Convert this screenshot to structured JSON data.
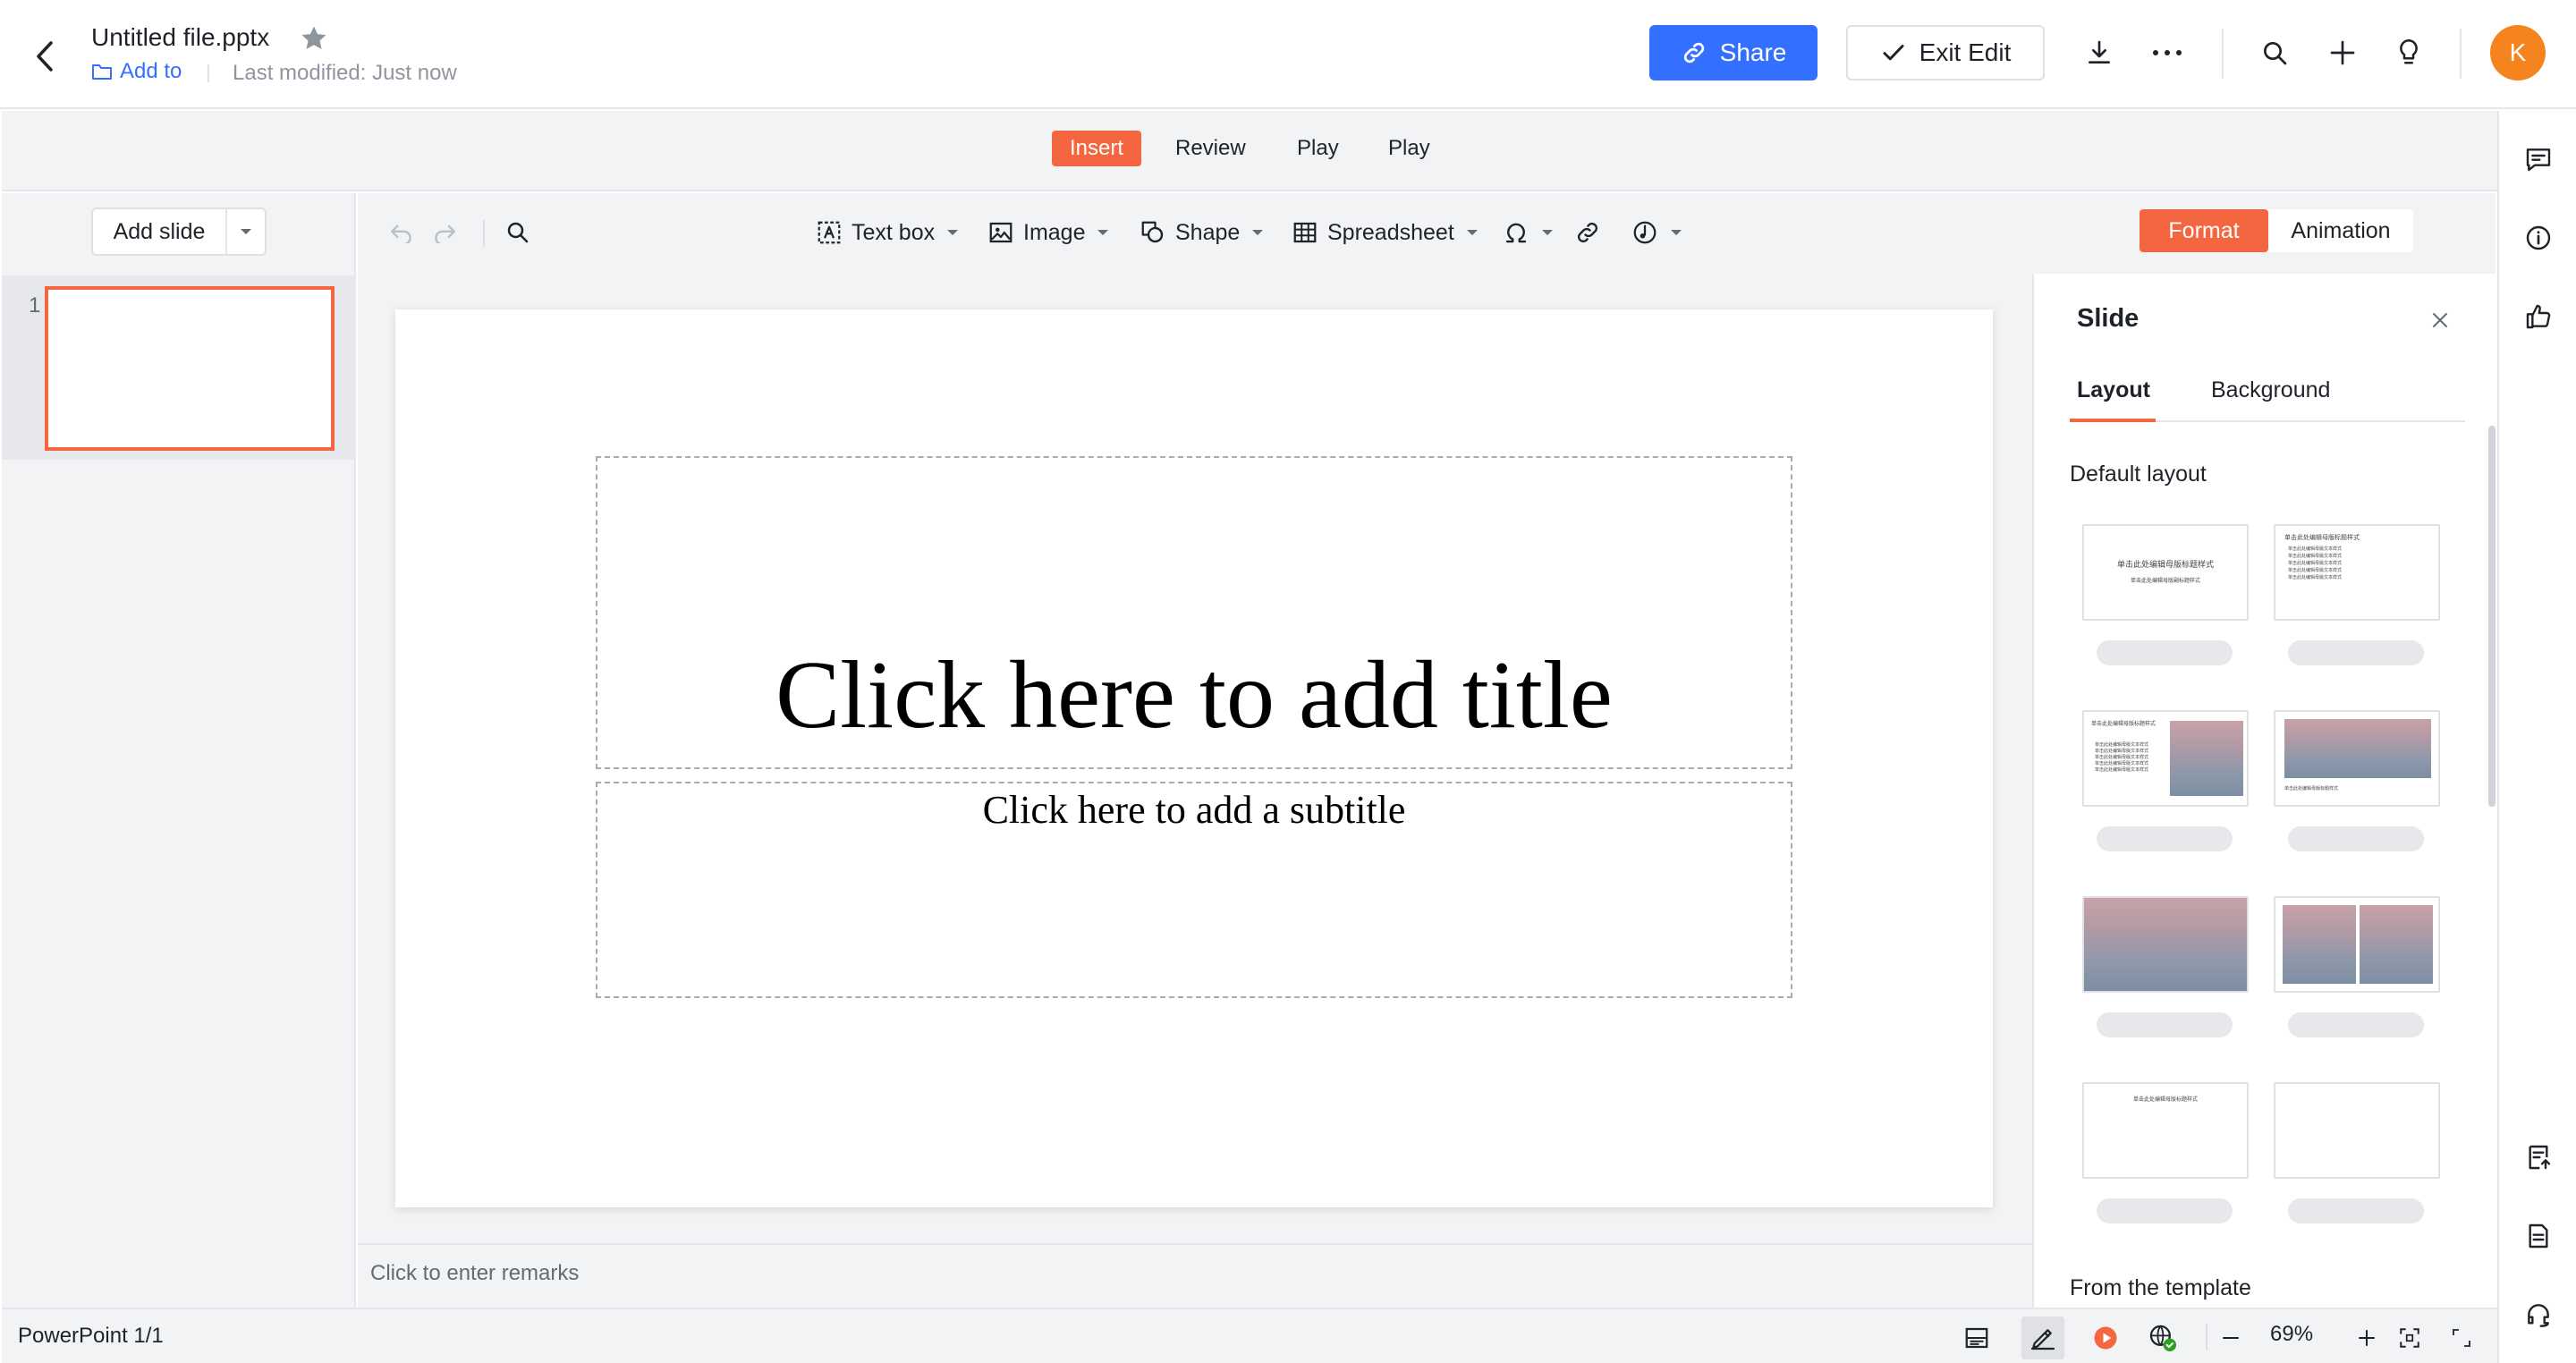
{
  "header": {
    "file_title": "Untitled file.pptx",
    "add_to": "Add to",
    "last_modified": "Last modified: Just now",
    "share_label": "Share",
    "exit_edit_label": "Exit Edit",
    "avatar_initial": "K"
  },
  "menu": {
    "tabs": [
      {
        "label": "Insert",
        "active": true
      },
      {
        "label": "Review",
        "active": false
      },
      {
        "label": "Play",
        "active": false
      },
      {
        "label": "Play",
        "active": false
      }
    ]
  },
  "slides_panel": {
    "add_slide_label": "Add slide",
    "slides": [
      {
        "number": "1",
        "selected": true
      }
    ]
  },
  "toolbar": {
    "text_box": "Text box",
    "image": "Image",
    "shape": "Shape",
    "spreadsheet": "Spreadsheet",
    "format": "Format",
    "animation": "Animation"
  },
  "slide": {
    "title_placeholder": "Click here to add title",
    "subtitle_placeholder": "Click here to add a subtitle"
  },
  "remarks": {
    "placeholder": "Click to enter remarks"
  },
  "side_panel": {
    "title": "Slide",
    "tabs": [
      {
        "label": "Layout",
        "active": true
      },
      {
        "label": "Background",
        "active": false
      }
    ],
    "default_layout_heading": "Default layout",
    "template_heading": "From the template",
    "layout_preview_text": {
      "title_slide_title": "单击此处编辑母版标题样式",
      "title_slide_subtitle": "单击此处编辑母版副标题样式",
      "content_title": "单击此处编辑母版标题样式",
      "bullet": "单击此处编辑母版文本样式"
    }
  },
  "status": {
    "doc_info": "PowerPoint 1/1",
    "zoom": "69%"
  },
  "colors": {
    "accent": "#f4663f",
    "primary_blue": "#3370ff",
    "avatar": "#f5841f",
    "bg_gray": "#f2f3f5"
  }
}
